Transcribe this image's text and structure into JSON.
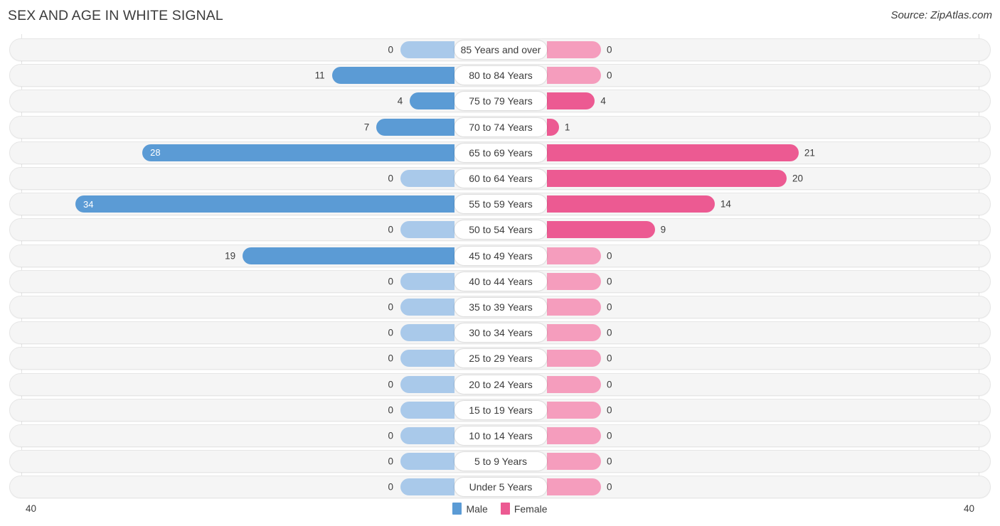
{
  "header": {
    "title": "SEX AND AGE IN WHITE SIGNAL",
    "source": "Source: ZipAtlas.com"
  },
  "legend": {
    "male_label": "Male",
    "female_label": "Female",
    "male_color": "#5B9BD5",
    "female_color": "#EC5A92",
    "male_zero_color": "#A9C9EA",
    "female_zero_color": "#F59DBD"
  },
  "axis": {
    "left_tick": "40",
    "right_tick": "40",
    "max": 40
  },
  "chart_data": {
    "type": "bar",
    "title": "SEX AND AGE IN WHITE SIGNAL",
    "subtitle": "",
    "xlabel": "",
    "ylabel": "",
    "orientation": "horizontal-diverging",
    "legend_position": "bottom-center",
    "grid": false,
    "xlim": [
      -40,
      40
    ],
    "axis_max": 40,
    "categories": [
      "85 Years and over",
      "80 to 84 Years",
      "75 to 79 Years",
      "70 to 74 Years",
      "65 to 69 Years",
      "60 to 64 Years",
      "55 to 59 Years",
      "50 to 54 Years",
      "45 to 49 Years",
      "40 to 44 Years",
      "35 to 39 Years",
      "30 to 34 Years",
      "25 to 29 Years",
      "20 to 24 Years",
      "15 to 19 Years",
      "10 to 14 Years",
      "5 to 9 Years",
      "Under 5 Years"
    ],
    "series": [
      {
        "name": "Male",
        "color": "#5B9BD5",
        "values": [
          0,
          11,
          4,
          7,
          28,
          0,
          34,
          0,
          19,
          0,
          0,
          0,
          0,
          0,
          0,
          0,
          0,
          0
        ]
      },
      {
        "name": "Female",
        "color": "#EC5A92",
        "values": [
          0,
          0,
          4,
          1,
          21,
          20,
          14,
          9,
          0,
          0,
          0,
          0,
          0,
          0,
          0,
          0,
          0,
          0
        ]
      }
    ]
  },
  "rows": [
    {
      "age": "85 Years and over",
      "male": "0",
      "female": "0"
    },
    {
      "age": "80 to 84 Years",
      "male": "11",
      "female": "0"
    },
    {
      "age": "75 to 79 Years",
      "male": "4",
      "female": "4"
    },
    {
      "age": "70 to 74 Years",
      "male": "7",
      "female": "1"
    },
    {
      "age": "65 to 69 Years",
      "male": "28",
      "female": "21"
    },
    {
      "age": "60 to 64 Years",
      "male": "0",
      "female": "20"
    },
    {
      "age": "55 to 59 Years",
      "male": "34",
      "female": "14"
    },
    {
      "age": "50 to 54 Years",
      "male": "0",
      "female": "9"
    },
    {
      "age": "45 to 49 Years",
      "male": "19",
      "female": "0"
    },
    {
      "age": "40 to 44 Years",
      "male": "0",
      "female": "0"
    },
    {
      "age": "35 to 39 Years",
      "male": "0",
      "female": "0"
    },
    {
      "age": "30 to 34 Years",
      "male": "0",
      "female": "0"
    },
    {
      "age": "25 to 29 Years",
      "male": "0",
      "female": "0"
    },
    {
      "age": "20 to 24 Years",
      "male": "0",
      "female": "0"
    },
    {
      "age": "15 to 19 Years",
      "male": "0",
      "female": "0"
    },
    {
      "age": "10 to 14 Years",
      "male": "0",
      "female": "0"
    },
    {
      "age": "5 to 9 Years",
      "male": "0",
      "female": "0"
    },
    {
      "age": "Under 5 Years",
      "male": "0",
      "female": "0"
    }
  ]
}
